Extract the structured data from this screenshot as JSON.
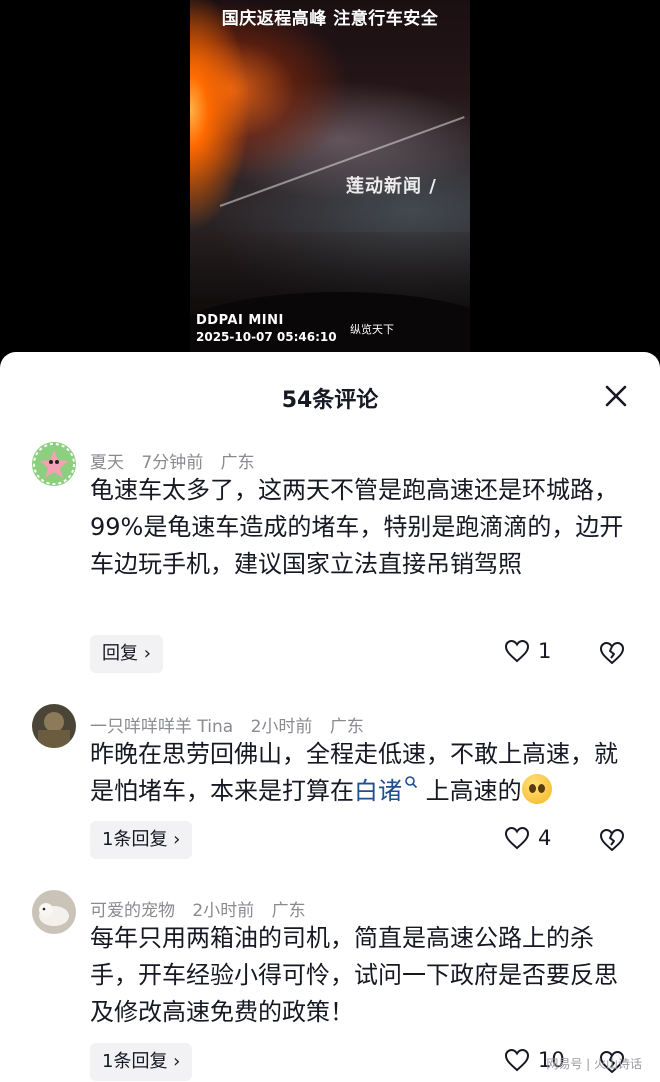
{
  "video": {
    "title": "国庆返程高峰 注意行车安全",
    "watermark": "莲动新闻 /",
    "brand": "DDPAI MINI",
    "timestamp": "2025-10-07  05:46:10",
    "tag": "纵览天下"
  },
  "comments_header": {
    "title": "54条评论"
  },
  "comments": [
    {
      "username": "夏天",
      "time": "7分钟前",
      "location": "广东",
      "text": "龟速车太多了，这两天不管是跑高速还是环城路，99%是龟速车造成的堵车，特别是跑滴滴的，边开车边玩手机，建议国家立法直接吊销驾照",
      "reply_label": "回复 ›",
      "likes": "1"
    },
    {
      "username": "一只咩咩咩羊 Tina",
      "time": "2小时前",
      "location": "广东",
      "text_before": "昨晚在思劳回佛山，全程走低速，不敢上高速，就是怕堵车，本来是打算在",
      "text_link": "白诸",
      "text_after": " 上高速的",
      "reply_label": "1条回复 ›",
      "likes": "4"
    },
    {
      "username": "可爱的宠物",
      "time": "2小时前",
      "location": "广东",
      "text": "每年只用两箱油的司机，简直是高速公路上的杀手，开车经验小得可怜，试问一下政府是否要反思及修改高速免费的政策！",
      "reply_label": "1条回复 ›",
      "likes": "10"
    }
  ],
  "corner_mark": "网易号 | 火山诗话",
  "colors": {
    "text": "#161823",
    "meta": "#8a8b91",
    "link": "#1f4f8f",
    "reply_bg": "#f2f2f4"
  }
}
